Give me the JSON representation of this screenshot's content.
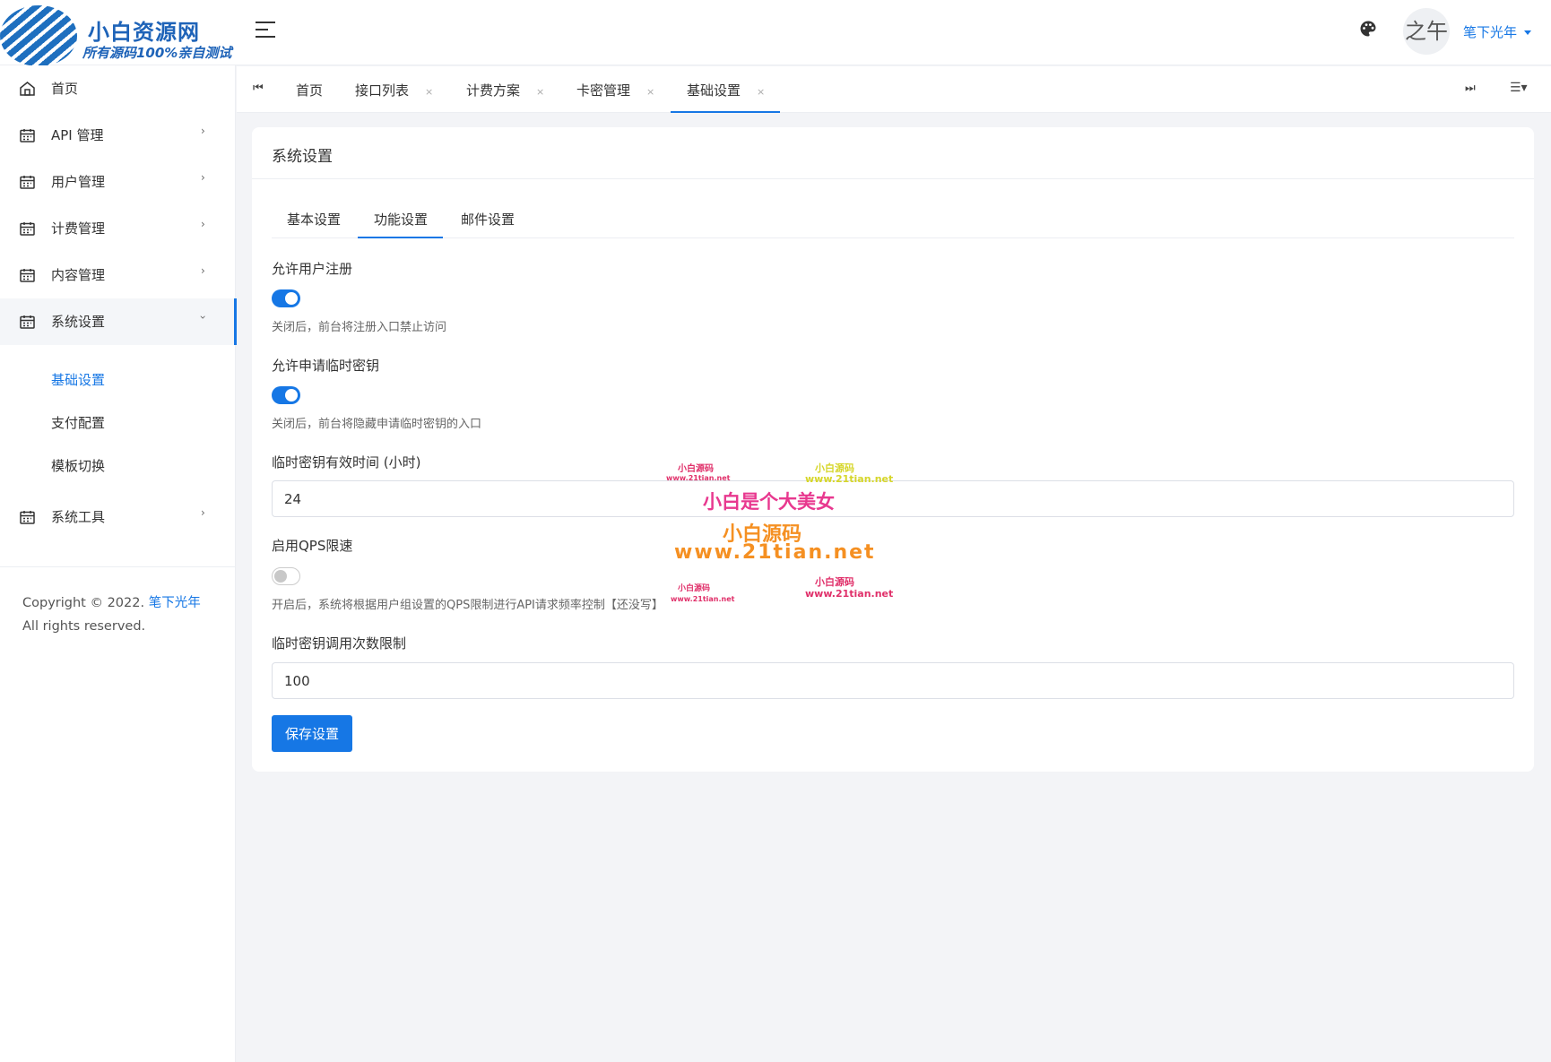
{
  "header": {
    "logo_title": "小白资源网",
    "logo_subtitle": "所有源码100%亲自测试",
    "avatar_text": "之午",
    "username": "笔下光年"
  },
  "sidebar": {
    "items": [
      {
        "label": "首页"
      },
      {
        "label": "API 管理"
      },
      {
        "label": "用户管理"
      },
      {
        "label": "计费管理"
      },
      {
        "label": "内容管理"
      },
      {
        "label": "系统设置"
      },
      {
        "label": "系统工具"
      }
    ],
    "sub_items": [
      {
        "label": "基础设置"
      },
      {
        "label": "支付配置"
      },
      {
        "label": "模板切换"
      }
    ],
    "copyright_prefix": "Copyright © 2022.",
    "copyright_brand": "笔下光年",
    "copyright_suffix": "All rights reserved."
  },
  "page_tabs": [
    {
      "label": "首页"
    },
    {
      "label": "接口列表"
    },
    {
      "label": "计费方案"
    },
    {
      "label": "卡密管理"
    },
    {
      "label": "基础设置"
    }
  ],
  "close_glyph": "×",
  "card": {
    "title": "系统设置",
    "tabs": [
      {
        "label": "基本设置"
      },
      {
        "label": "功能设置"
      },
      {
        "label": "邮件设置"
      }
    ],
    "fields": {
      "allow_register": {
        "label": "允许用户注册",
        "help": "关闭后，前台将注册入口禁止访问",
        "enabled": true
      },
      "allow_temp_key": {
        "label": "允许申请临时密钥",
        "help": "关闭后，前台将隐藏申请临时密钥的入口",
        "enabled": true
      },
      "temp_key_hours": {
        "label": "临时密钥有效时间 (小时)",
        "value": "24"
      },
      "qps_limit": {
        "label": "启用QPS限速",
        "help": "开启后，系统将根据用户组设置的QPS限制进行API请求频率控制【还没写】",
        "enabled": false
      },
      "temp_key_calls": {
        "label": "临时密钥调用次数限制",
        "value": "100"
      }
    },
    "save_label": "保存设置"
  },
  "watermark": {
    "small_a": "小白源码",
    "small_url": "www.21tian.net",
    "main": "小白是个大美女",
    "brand": "小白源码",
    "url": "www.21tian.net"
  }
}
